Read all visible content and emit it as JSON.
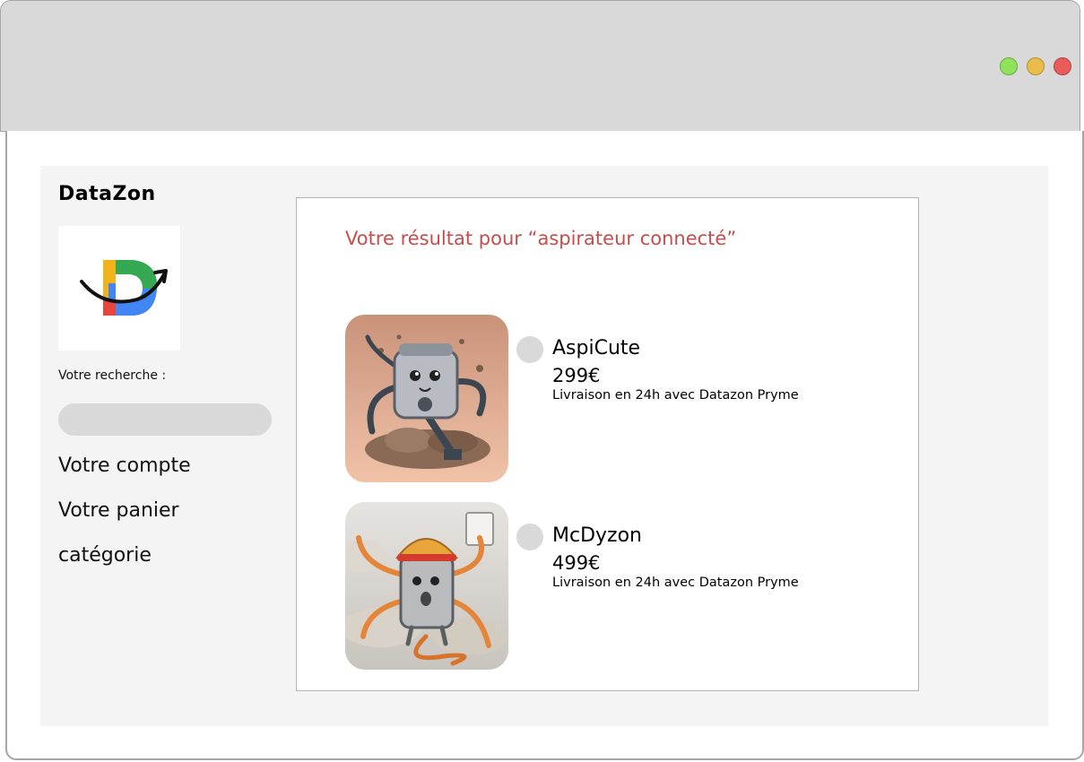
{
  "window": {
    "controls": [
      {
        "name": "maximize",
        "color": "#8ee35a"
      },
      {
        "name": "minimize",
        "color": "#e8bd4a"
      },
      {
        "name": "close",
        "color": "#ea5b5b"
      }
    ]
  },
  "sidebar": {
    "brand": "DataZon",
    "search_label": "Votre recherche :",
    "search_value": "",
    "nav": [
      "Votre compte",
      "Votre panier",
      "catégorie"
    ]
  },
  "results": {
    "title": "Votre résultat pour “aspirateur connecté”",
    "title_color": "#c94c4c",
    "products": [
      {
        "name": "AspiCute",
        "price": "299€",
        "shipping": "Livraison en 24h avec Datazon Pryme",
        "image_icon": "cute-vacuum-robot-image"
      },
      {
        "name": "McDyzon",
        "price": "499€",
        "shipping": "Livraison en 24h avec Datazon Pryme",
        "image_icon": "chaotic-vacuum-robot-image"
      }
    ]
  }
}
